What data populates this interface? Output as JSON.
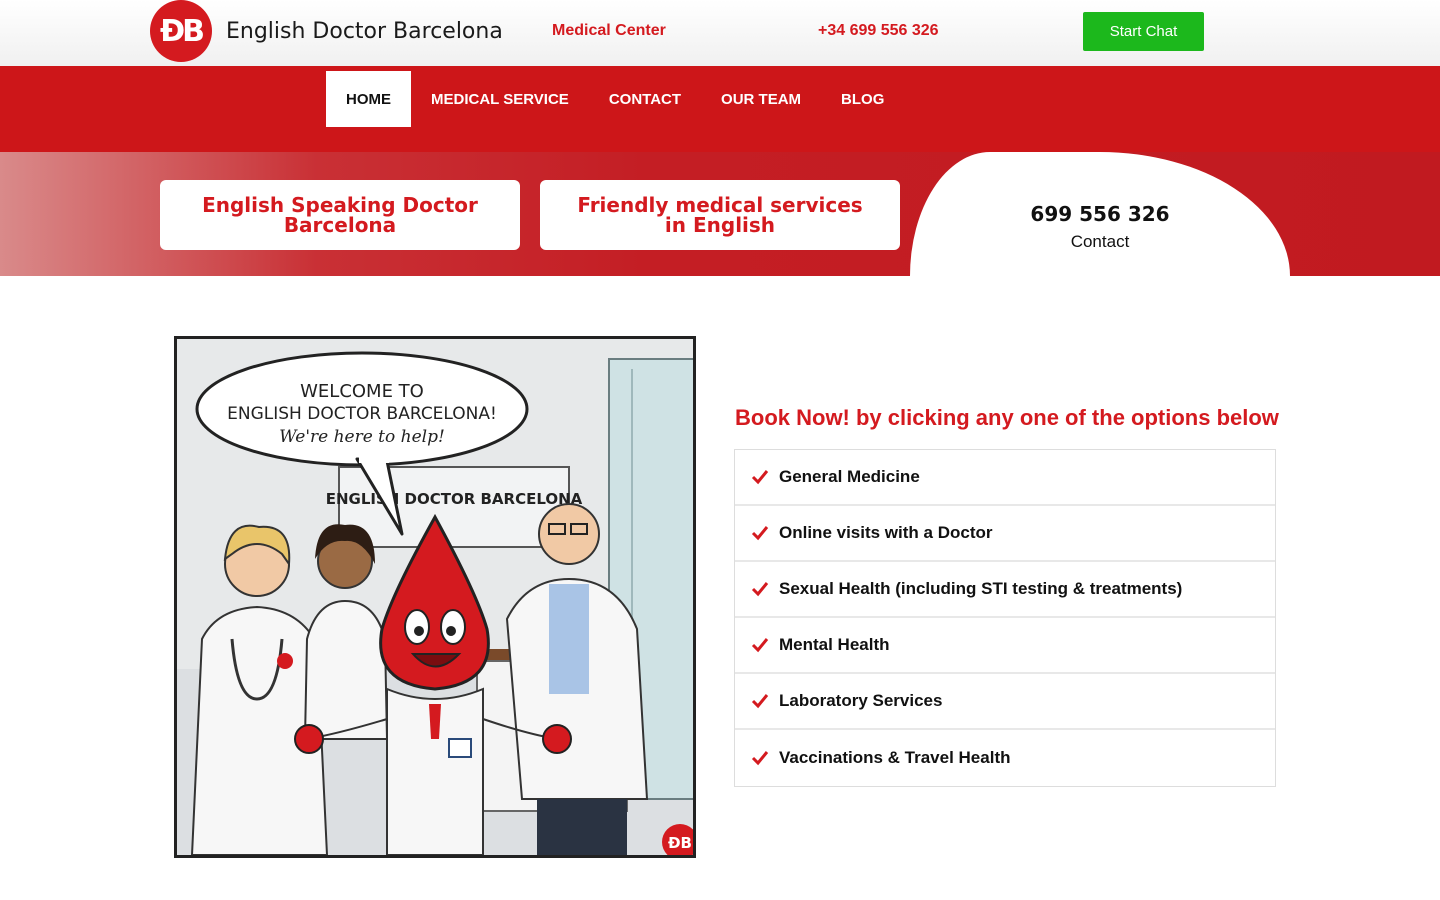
{
  "brand": {
    "logo_text": "English Doctor Barcelona",
    "logo_mark": "ÐB",
    "accent": "#d41a1f",
    "chat_color": "#1cb81c"
  },
  "header": {
    "medical_center": "Medical Center",
    "phone": "+34 699 556 326",
    "chat_label": "Start Chat"
  },
  "nav": {
    "items": [
      "HOME",
      "MEDICAL SERVICE",
      "CONTACT",
      "OUR TEAM",
      "BLOG"
    ],
    "active": "HOME"
  },
  "hero": {
    "card1": "English Speaking Doctor Barcelona",
    "card2": "Friendly medical services in English",
    "phone": "699 556 326",
    "contact": "Contact"
  },
  "illustration": {
    "bubble_line1": "WELCOME TO",
    "bubble_line2": "ENGLISH DOCTOR BARCELONA!",
    "bubble_line3": "We're here to help!",
    "sign": "ENGLISH DOCTOR BARCELONA",
    "badge": "ÐB"
  },
  "booking": {
    "title": "Book Now! by clicking any one of the options below",
    "options": [
      "General Medicine",
      "Online visits with a Doctor",
      "Sexual Health (including STI testing & treatments)",
      "Mental Health",
      "Laboratory Services",
      "Vaccinations & Travel Health"
    ]
  }
}
